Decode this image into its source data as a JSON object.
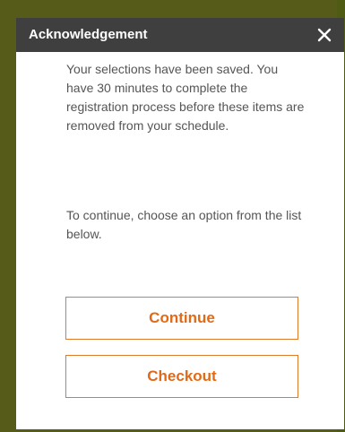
{
  "dialog": {
    "title": "Acknowledgement",
    "close_icon": "close-icon",
    "message_1": "Your selections have been saved. You have 30 minutes to complete the registration process before these items are removed from your schedule.",
    "message_2": "To continue, choose an option from the list below.",
    "continue_label": "Continue",
    "checkout_label": "Checkout"
  },
  "colors": {
    "backdrop": "#575b19",
    "header": "#3f3f3f",
    "accent": "#e06a17",
    "button_border": "#e07b2c",
    "body_text": "#555555"
  }
}
